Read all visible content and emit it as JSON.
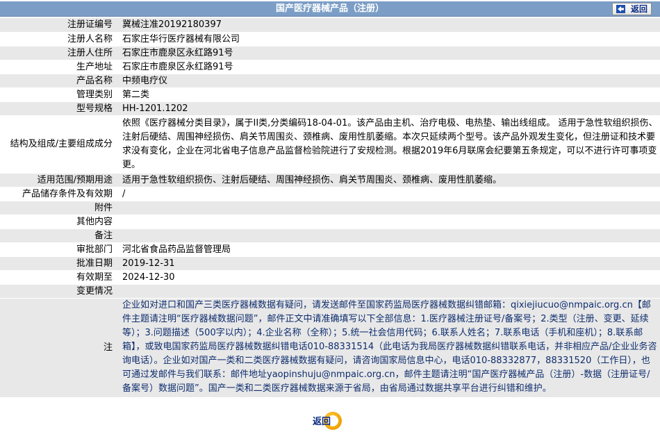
{
  "header": {
    "title": "国产医疗器械产品（注册）",
    "back_label": "返回"
  },
  "fields": [
    {
      "label": "注册证编号",
      "value": "冀械注准20192180397"
    },
    {
      "label": "注册人名称",
      "value": "石家庄华行医疗器械有限公司"
    },
    {
      "label": "注册人住所",
      "value": "石家庄市鹿泉区永红路91号"
    },
    {
      "label": "生产地址",
      "value": "石家庄市鹿泉区永红路91号"
    },
    {
      "label": "产品名称",
      "value": "中频电疗仪"
    },
    {
      "label": "管理类别",
      "value": "第二类"
    },
    {
      "label": "型号规格",
      "value": "HH-1201.1202"
    },
    {
      "label": "结构及组成/主要组成成分",
      "value": "依照《医疗器械分类目录》，属于II类,分类编码18-04-01。该产品由主机、治疗电极、电热垫、输出线组成。 适用于急性软组织损伤、注射后硬结、周围神经损伤、肩关节周围炎、颈椎病、废用性肌萎缩。本次只延续两个型号。该产品外观发生变化，但注册证和技术要求没有变化，企业在河北省电子信息产品监督检验院进行了安规检测。根据2019年6月联席会纪要第五条规定，可以不进行许可事项变更。"
    },
    {
      "label": "适用范围/预期用途",
      "value": "适用于急性软组织损伤、注射后硬结、周围神经损伤、肩关节周围炎、颈椎病、废用性肌萎缩。"
    },
    {
      "label": "产品储存条件及有效期",
      "value": "/"
    },
    {
      "label": "附件",
      "value": ""
    },
    {
      "label": "其他内容",
      "value": ""
    },
    {
      "label": "备注",
      "value": ""
    },
    {
      "label": "审批部门",
      "value": "河北省食品药品监督管理局"
    },
    {
      "label": "批准日期",
      "value": "2019-12-31"
    },
    {
      "label": "有效期至",
      "value": "2024-12-30"
    },
    {
      "label": "变更情况",
      "value": ""
    }
  ],
  "notice": {
    "label": "注",
    "text": "企业如对进口和国产三类医疗器械数据有疑问，请发送邮件至国家药监局医疗器械数据纠错邮箱：qixiejiucuo@nmpaic.org.cn【邮件主题请注明“医疗器械数据问题”，邮件正文中请准确填写以下全部信息：1.医疗器械注册证号/备案号；2.类型（注册、变更、延续等）；3.问题描述（500字以内）；4.企业名称（全称）；5.统一社会信用代码；6.联系人姓名；7.联系电话（手机和座机）；8.联系邮箱】，或致电国家药监局医疗器械数据纠错电话010-88331514（此电话为我局医疗器械数据纠错联系电话，并非相应产品/企业业务咨询电话）。企业如对国产一类和二类医疗器械数据有疑问，请咨询国家局信息中心，电话010-88332877，88331520（工作日），也可通过发邮件与我们联系：邮件地址yaopinshuju@nmpaic.org.cn，邮件主题请注明“国产医疗器械产品（注册）-数据（注册证号/备案号）数据问题”。国产一类和二类医疗器械数据来源于省局，由省局通过数据共享平台进行纠错和维护。"
  },
  "footer": {
    "back_label": "返回"
  }
}
